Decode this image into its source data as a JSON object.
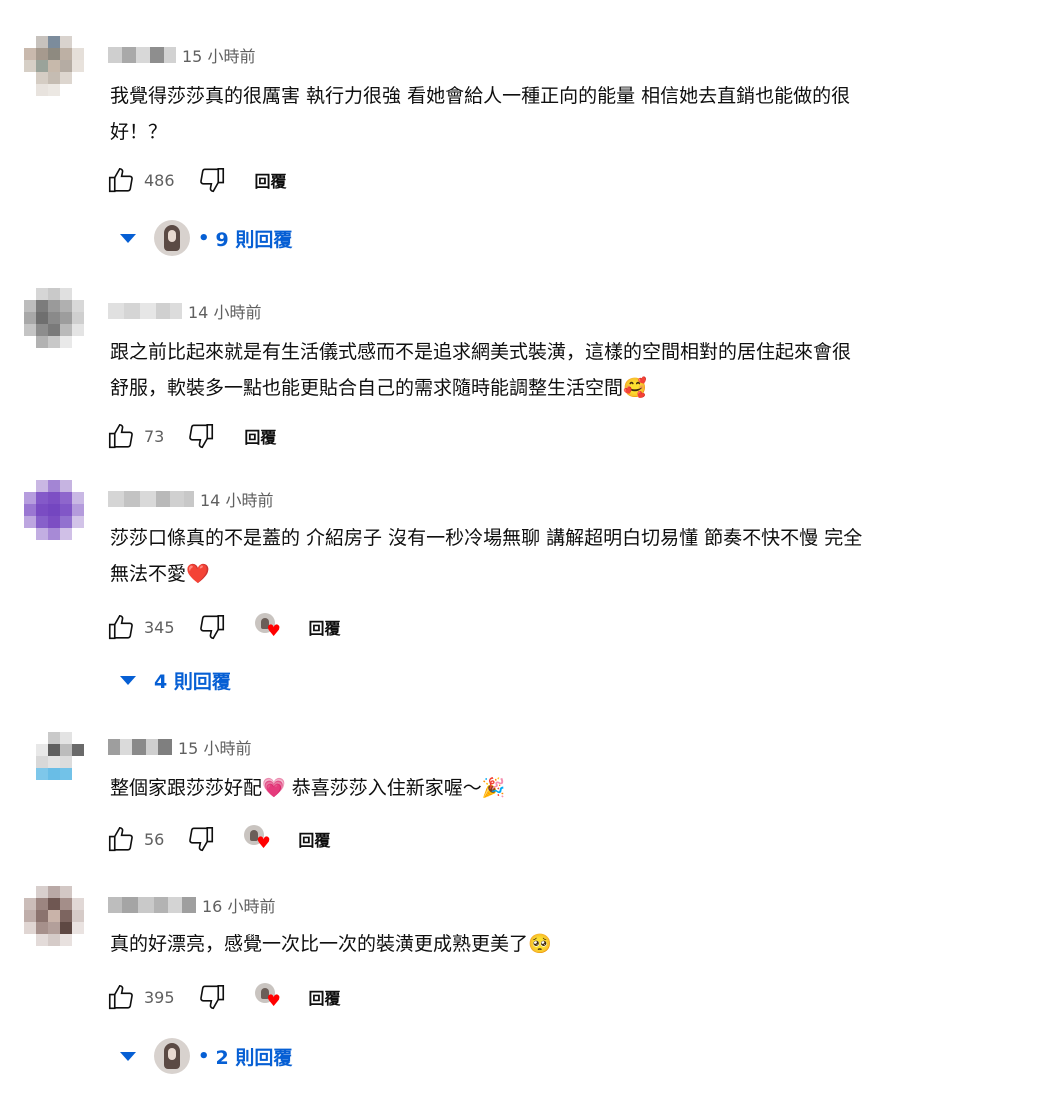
{
  "reply_label": "回覆",
  "colors": {
    "link_blue": "#065fd4",
    "heart_red": "#ff0000",
    "meta_gray": "#606060"
  },
  "comments": [
    {
      "time": "15 小時前",
      "text_line1": "我覺得莎莎真的很厲害 執行力很強 看她會給人一種正向的能量 相信她去直銷也能做的很",
      "text_line2": "好！？",
      "likes": "486",
      "replies": "9 則回覆"
    },
    {
      "time": "14 小時前",
      "text_line1": "跟之前比起來就是有生活儀式感而不是追求網美式裝潢，這樣的空間相對的居住起來會很",
      "text_line2": "舒服，軟裝多一點也能更貼合自己的需求隨時能調整生活空間🥰",
      "likes": "73"
    },
    {
      "time": "14 小時前",
      "text_line1": "莎莎口條真的不是蓋的 介紹房子 沒有一秒冷場無聊  講解超明白切易懂 節奏不快不慢 完全",
      "text_line2": "無法不愛❤️",
      "likes": "345",
      "replies": "4 則回覆"
    },
    {
      "time": "15 小時前",
      "text_line1": "整個家跟莎莎好配💗 恭喜莎莎入住新家喔～🎉",
      "likes": "56"
    },
    {
      "time": "16 小時前",
      "text_line1": "真的好漂亮，感覺一次比一次的裝潢更成熟更美了🥺",
      "likes": "395",
      "replies": "2 則回覆"
    }
  ]
}
